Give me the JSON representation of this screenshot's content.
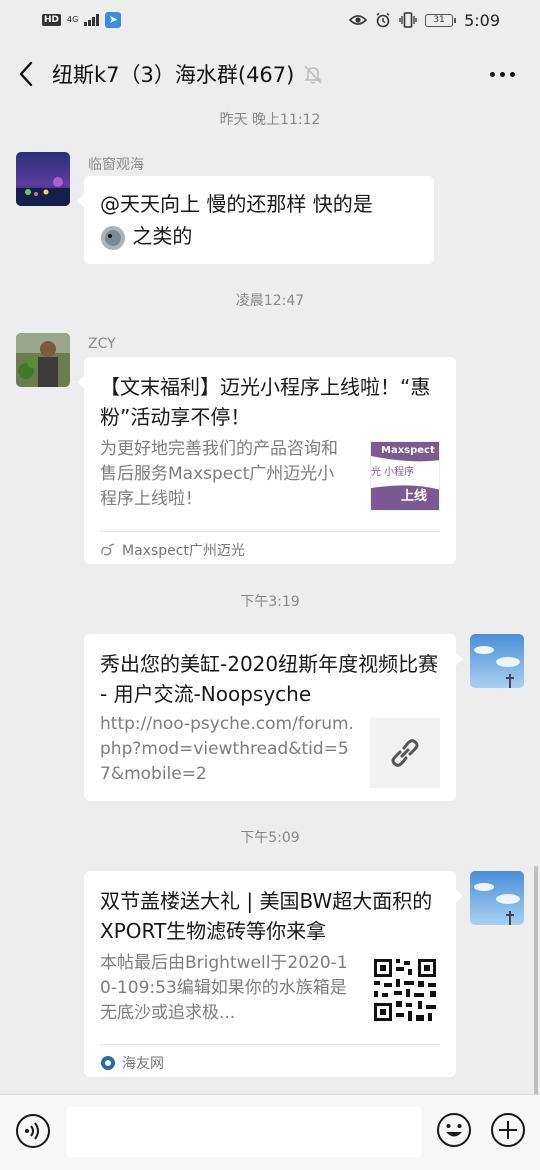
{
  "status_bar": {
    "hd": "HD",
    "network": "4G",
    "battery": "31",
    "time": "5:09",
    "icons": [
      "eye-icon",
      "alarm-icon",
      "vibrate-icon"
    ]
  },
  "header": {
    "title": "纽斯k7（3）海水群(467)",
    "back_icon": "chevron-left-icon",
    "mute_icon": "bell-off-icon",
    "more_icon": "more-dots-icon"
  },
  "messages": [
    {
      "time": "昨天 晚上11:12",
      "sender": "临窗观海",
      "text_line1": "@天天向上  慢的还那样 快的是",
      "text_line2": "之类的",
      "emoji": "bird-emoji"
    },
    {
      "time": "凌晨12:47",
      "sender": "ZCY",
      "card_title": "【文末福利】迈光小程序上线啦！“惠粉”活动享不停！",
      "card_desc": "为更好地完善我们的产品咨询和售后服务Maxspect广州迈光小程序上线啦！",
      "thumb_text_top": "Maxspect",
      "thumb_text_mid": "光 小程序",
      "thumb_text_bottom": "上线",
      "source": "Maxspect广州迈光"
    },
    {
      "time": "下午3:19",
      "card_title": "秀出您的美缸-2020纽斯年度视频比赛 - 用户交流-Noopsyche",
      "card_desc": "http://noo-psyche.com/forum.php?mod=viewthread&tid=57&mobile=2",
      "thumb_icon": "link-icon"
    },
    {
      "time": "下午5:09",
      "card_title": "双节盖楼送大礼 | 美国BW超大面积的XPORT生物滤砖等你来拿",
      "card_desc": "本帖最后由Brightwell于2020-10-109:53编辑如果你的水族箱是无底沙或追求极...",
      "thumb_icon": "qr-code-icon",
      "source": "海友网"
    }
  ],
  "input_bar": {
    "voice_icon": "voice-icon",
    "emoji_icon": "smiley-icon",
    "plus_icon": "plus-icon",
    "placeholder": ""
  },
  "colors": {
    "background": "#ededed",
    "bubble": "#ffffff",
    "timestamp": "#888888",
    "card_desc": "#7d7d7d",
    "thumb_purple": "#7b5a92"
  }
}
